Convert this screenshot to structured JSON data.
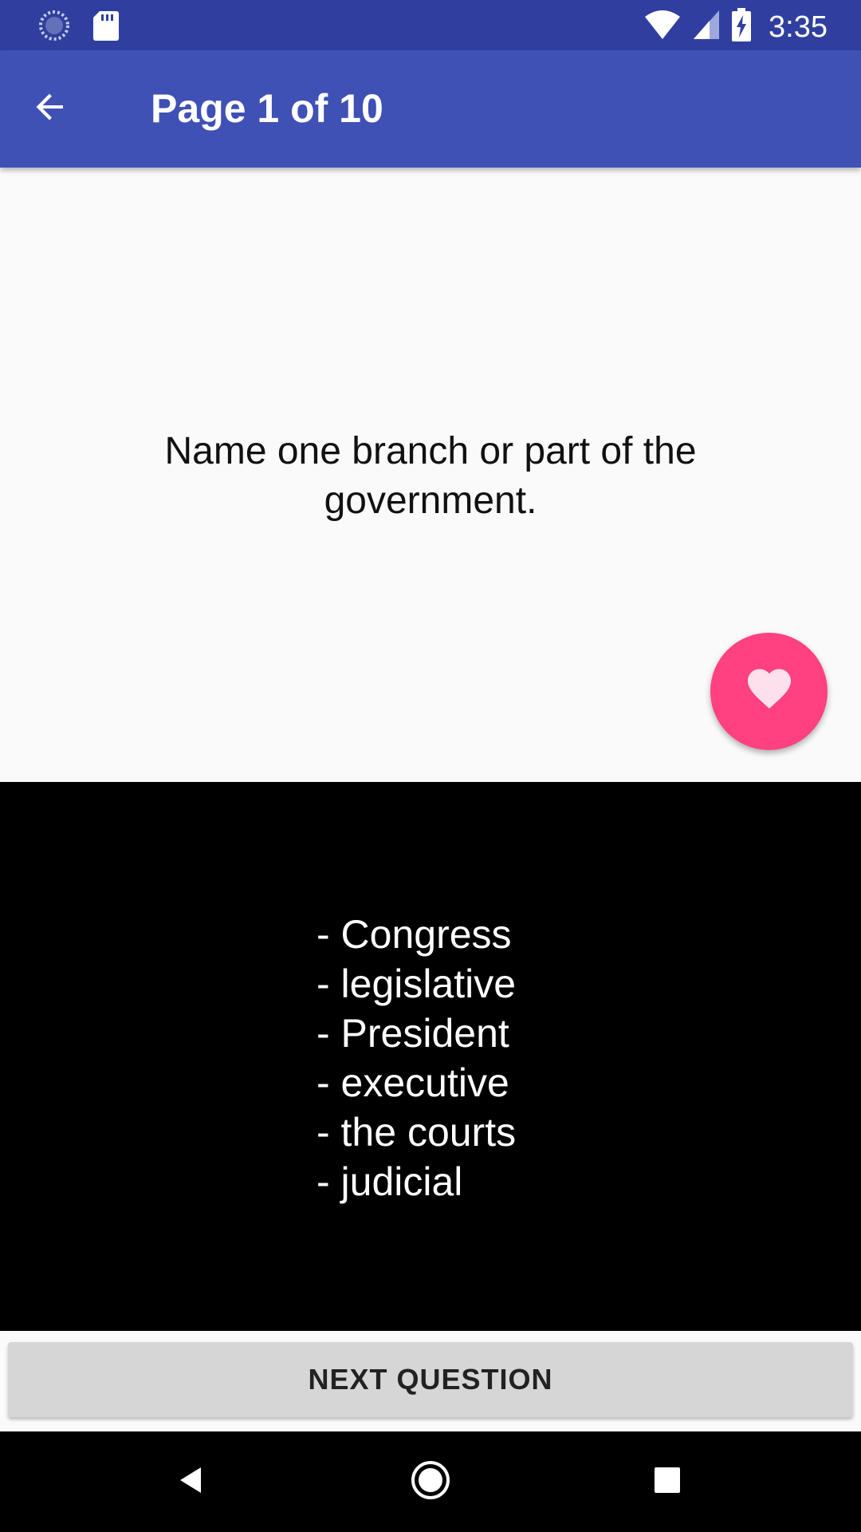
{
  "status_bar": {
    "time": "3:35",
    "icons": [
      "sync-icon",
      "sd-card-icon",
      "wifi-icon",
      "cell-signal-icon",
      "battery-charging-icon"
    ]
  },
  "app_bar": {
    "title": "Page 1 of 10",
    "back_icon": "arrow-back-icon"
  },
  "question": {
    "text": "Name one branch or part of the government."
  },
  "fab": {
    "icon": "heart-icon",
    "color": "#ff4081"
  },
  "answers": [
    "- Congress",
    "- legislative",
    "- President",
    "- executive",
    "- the courts",
    "- judicial"
  ],
  "next_button": {
    "label": "NEXT QUESTION"
  },
  "nav_bar": {
    "icons": [
      "back-triangle-icon",
      "home-circle-icon",
      "recents-square-icon"
    ]
  },
  "colors": {
    "status_bar": "#303f9f",
    "app_bar": "#3f51b5",
    "accent": "#ff4081",
    "answer_bg": "#000000"
  }
}
